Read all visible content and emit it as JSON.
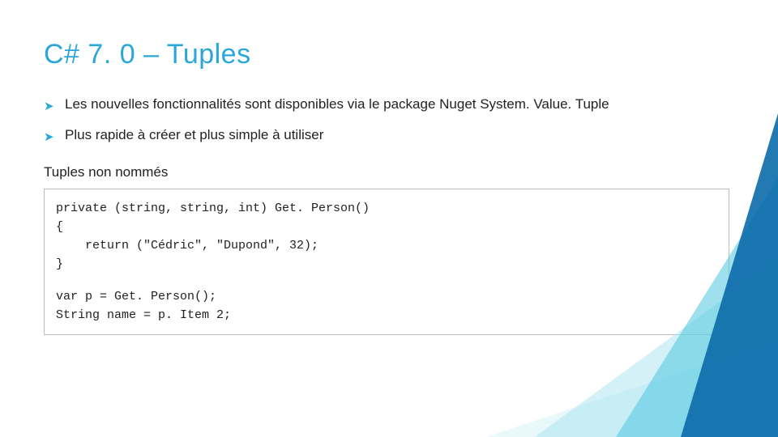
{
  "title": "C# 7. 0 – Tuples",
  "bullets": [
    "Les nouvelles fonctionnalités sont disponibles via le package Nuget System. Value. Tuple",
    "Plus rapide à créer et plus simple à utiliser"
  ],
  "subhead": "Tuples non nommés",
  "code": {
    "line1": "private (string, string, int) Get. Person()",
    "line2": "{",
    "line3": "    return (\"Cédric\", \"Dupond\", 32);",
    "line4": "}",
    "line5": "var p = Get. Person();",
    "line6": "String name = p. Item 2;"
  }
}
